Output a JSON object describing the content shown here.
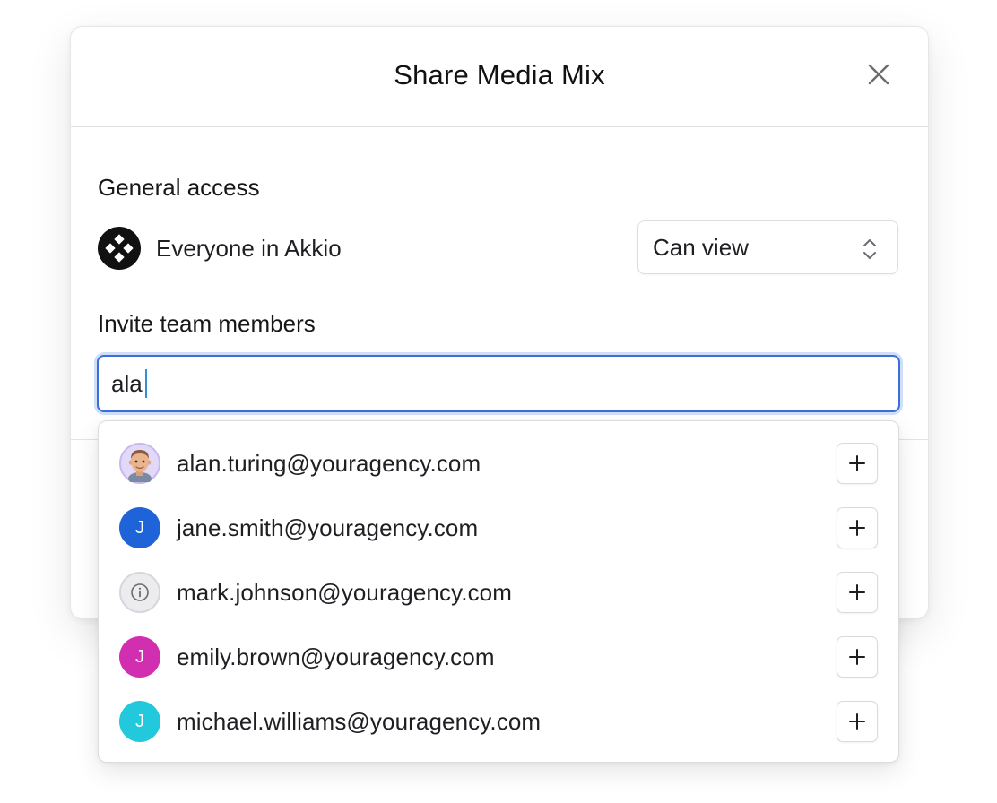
{
  "modal": {
    "title": "Share Media Mix"
  },
  "general_access": {
    "label": "General access",
    "org_name": "Everyone in Akkio",
    "permission": "Can view"
  },
  "invite": {
    "label": "Invite team members",
    "input_value": "ala"
  },
  "suggestions": [
    {
      "email": "alan.turing@youragency.com",
      "avatar_type": "memoji",
      "avatar_color": "#d9cdf5"
    },
    {
      "email": "jane.smith@youragency.com",
      "avatar_type": "initial",
      "initial": "J",
      "avatar_color": "#1f63d9"
    },
    {
      "email": "mark.johnson@youragency.com",
      "avatar_type": "info-icon",
      "avatar_color": "#ececef"
    },
    {
      "email": "emily.brown@youragency.com",
      "avatar_type": "initial",
      "initial": "J",
      "avatar_color": "#d12fb0"
    },
    {
      "email": "michael.williams@youragency.com",
      "avatar_type": "initial",
      "initial": "J",
      "avatar_color": "#22c8dc"
    }
  ],
  "colors": {
    "focus_ring": "#3b6fd6",
    "caret": "#2f8fd8"
  }
}
